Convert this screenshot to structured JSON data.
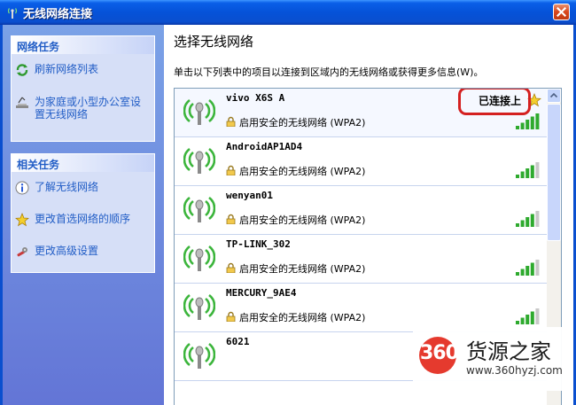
{
  "window": {
    "title": "无线网络连接"
  },
  "left": {
    "network_tasks": {
      "header": "网络任务",
      "items": [
        {
          "label": "刷新网络列表",
          "icon": "refresh-icon"
        },
        {
          "label": "为家庭或小型办公室设置无线网络",
          "icon": "network-setup-icon"
        }
      ]
    },
    "related_tasks": {
      "header": "相关任务",
      "items": [
        {
          "label": "了解无线网络",
          "icon": "info-icon"
        },
        {
          "label": "更改首选网络的顺序",
          "icon": "star-icon"
        },
        {
          "label": "更改高级设置",
          "icon": "settings-icon"
        }
      ]
    }
  },
  "main": {
    "title": "选择无线网络",
    "instruction": "单击以下列表中的项目以连接到区域内的无线网络或获得更多信息(W)。",
    "networks": [
      {
        "ssid": "vivo X6S A",
        "security": "启用安全的无线网络 (WPA2)",
        "status": "已连接上",
        "signal": 1.0,
        "connected": true
      },
      {
        "ssid": "AndroidAP1AD4",
        "security": "启用安全的无线网络 (WPA2)",
        "signal": 0.8
      },
      {
        "ssid": "wenyan01",
        "security": "启用安全的无线网络 (WPA2)",
        "signal": 0.8
      },
      {
        "ssid": "TP-LINK_302",
        "security": "启用安全的无线网络 (WPA2)",
        "signal": 0.8
      },
      {
        "ssid": "MERCURY_9AE4",
        "security": "启用安全的无线网络 (WPA2)",
        "signal": 0.8
      },
      {
        "ssid": "6021"
      }
    ]
  },
  "watermark": {
    "number": "360",
    "brand": "货源之家",
    "url": "www.360hyzj.com"
  },
  "colors": {
    "titlebar": "#0552d8",
    "task_link": "#215dc6",
    "highlight": "#d42020",
    "signal": "#2eaa2e"
  }
}
